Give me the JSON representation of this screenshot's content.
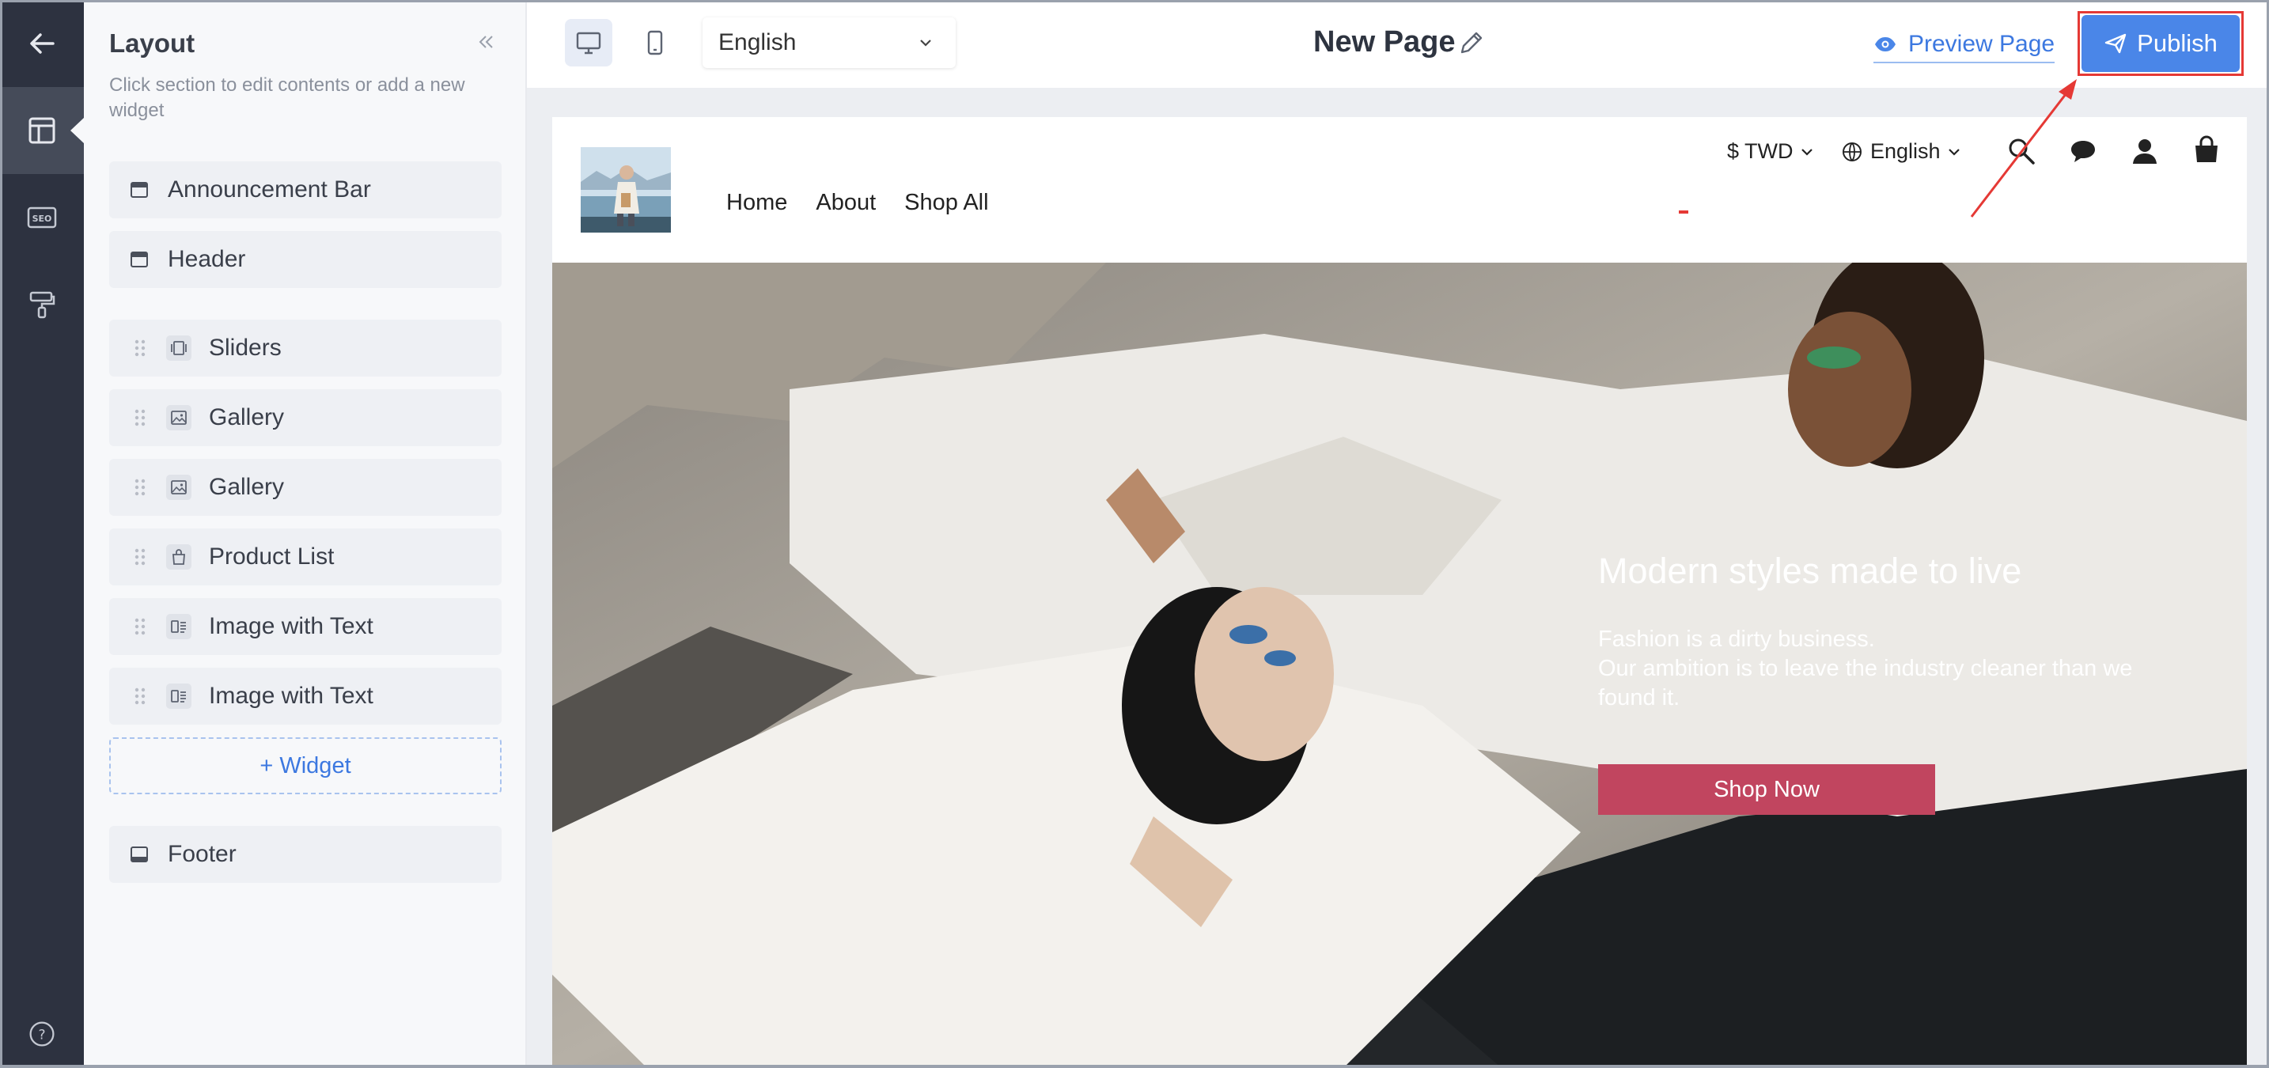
{
  "rail": {
    "items": [
      {
        "icon": "back-arrow-icon"
      },
      {
        "icon": "layout-icon",
        "active": true
      },
      {
        "icon": "seo-icon",
        "text": "SEO"
      },
      {
        "icon": "paint-roller-icon"
      },
      {
        "icon": "help-icon",
        "text": "?"
      }
    ]
  },
  "panel": {
    "title": "Layout",
    "description": "Click section to edit contents or add a new widget",
    "fixed_top": [
      {
        "label": "Announcement Bar",
        "icon": "section-top-icon"
      },
      {
        "label": "Header",
        "icon": "section-top-icon"
      }
    ],
    "widgets": [
      {
        "label": "Sliders",
        "icon": "slider-icon"
      },
      {
        "label": "Gallery",
        "icon": "image-icon"
      },
      {
        "label": "Gallery",
        "icon": "image-icon"
      },
      {
        "label": "Product List",
        "icon": "bag-icon"
      },
      {
        "label": "Image with Text",
        "icon": "image-text-icon"
      },
      {
        "label": "Image with Text",
        "icon": "image-text-icon"
      }
    ],
    "add_widget_label": "+ Widget",
    "fixed_bottom": [
      {
        "label": "Footer",
        "icon": "section-bottom-icon"
      }
    ]
  },
  "toolbar": {
    "language_value": "English",
    "page_title": "New Page",
    "preview_label": "Preview Page",
    "publish_label": "Publish"
  },
  "site": {
    "nav": [
      "Home",
      "About",
      "Shop All"
    ],
    "currency": "$ TWD",
    "language": "English",
    "hero": {
      "title": "Modern styles made to live",
      "line1": "Fashion is a dirty business.",
      "line2": "Our ambition is to leave the industry cleaner than we found it.",
      "button": "Shop Now"
    }
  },
  "colors": {
    "rail_bg": "#2d3240",
    "accent": "#4a86e8",
    "annotation": "#e53935",
    "hero_button": "#c1455f"
  }
}
